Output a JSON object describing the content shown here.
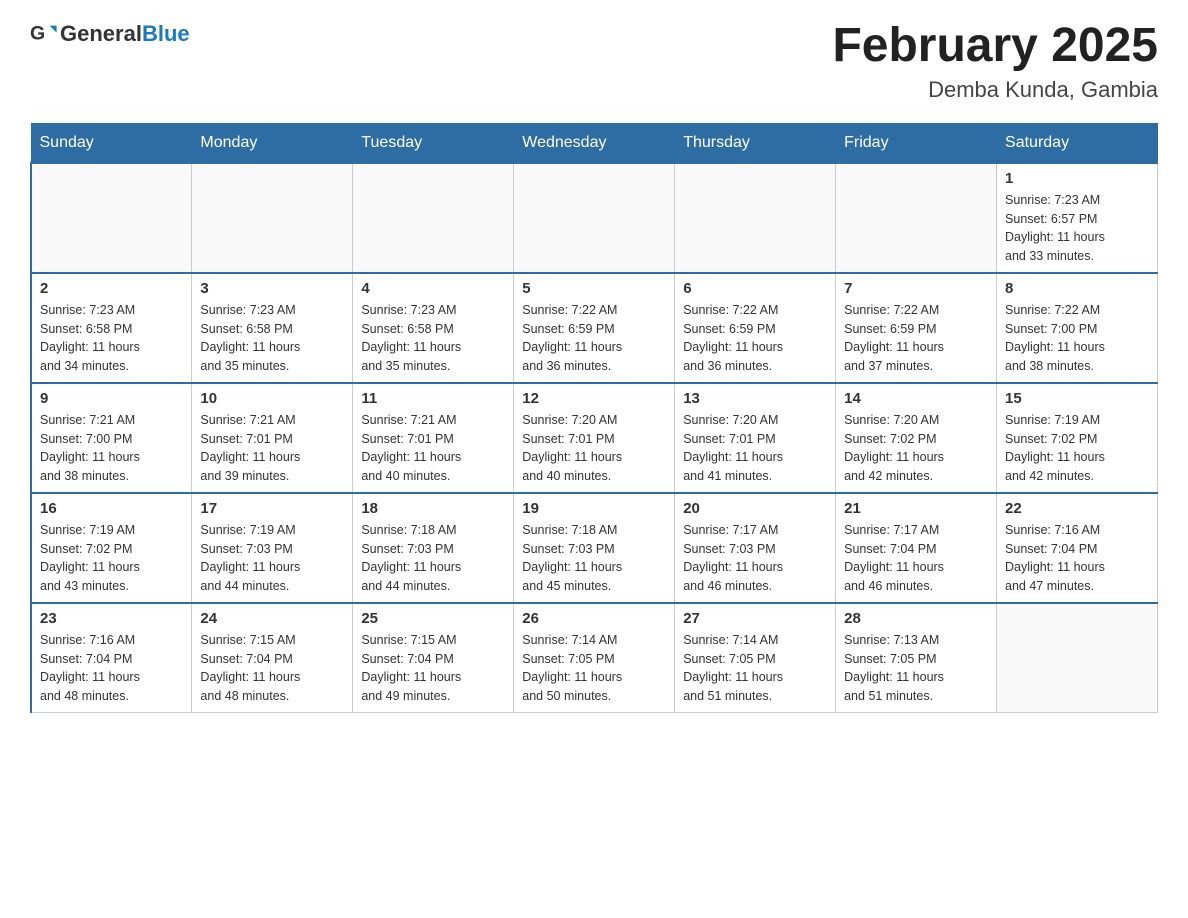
{
  "header": {
    "logo_general": "General",
    "logo_blue": "Blue",
    "month_title": "February 2025",
    "location": "Demba Kunda, Gambia"
  },
  "days_of_week": [
    "Sunday",
    "Monday",
    "Tuesday",
    "Wednesday",
    "Thursday",
    "Friday",
    "Saturday"
  ],
  "weeks": [
    {
      "days": [
        {
          "num": "",
          "info": ""
        },
        {
          "num": "",
          "info": ""
        },
        {
          "num": "",
          "info": ""
        },
        {
          "num": "",
          "info": ""
        },
        {
          "num": "",
          "info": ""
        },
        {
          "num": "",
          "info": ""
        },
        {
          "num": "1",
          "info": "Sunrise: 7:23 AM\nSunset: 6:57 PM\nDaylight: 11 hours\nand 33 minutes."
        }
      ]
    },
    {
      "days": [
        {
          "num": "2",
          "info": "Sunrise: 7:23 AM\nSunset: 6:58 PM\nDaylight: 11 hours\nand 34 minutes."
        },
        {
          "num": "3",
          "info": "Sunrise: 7:23 AM\nSunset: 6:58 PM\nDaylight: 11 hours\nand 35 minutes."
        },
        {
          "num": "4",
          "info": "Sunrise: 7:23 AM\nSunset: 6:58 PM\nDaylight: 11 hours\nand 35 minutes."
        },
        {
          "num": "5",
          "info": "Sunrise: 7:22 AM\nSunset: 6:59 PM\nDaylight: 11 hours\nand 36 minutes."
        },
        {
          "num": "6",
          "info": "Sunrise: 7:22 AM\nSunset: 6:59 PM\nDaylight: 11 hours\nand 36 minutes."
        },
        {
          "num": "7",
          "info": "Sunrise: 7:22 AM\nSunset: 6:59 PM\nDaylight: 11 hours\nand 37 minutes."
        },
        {
          "num": "8",
          "info": "Sunrise: 7:22 AM\nSunset: 7:00 PM\nDaylight: 11 hours\nand 38 minutes."
        }
      ]
    },
    {
      "days": [
        {
          "num": "9",
          "info": "Sunrise: 7:21 AM\nSunset: 7:00 PM\nDaylight: 11 hours\nand 38 minutes."
        },
        {
          "num": "10",
          "info": "Sunrise: 7:21 AM\nSunset: 7:01 PM\nDaylight: 11 hours\nand 39 minutes."
        },
        {
          "num": "11",
          "info": "Sunrise: 7:21 AM\nSunset: 7:01 PM\nDaylight: 11 hours\nand 40 minutes."
        },
        {
          "num": "12",
          "info": "Sunrise: 7:20 AM\nSunset: 7:01 PM\nDaylight: 11 hours\nand 40 minutes."
        },
        {
          "num": "13",
          "info": "Sunrise: 7:20 AM\nSunset: 7:01 PM\nDaylight: 11 hours\nand 41 minutes."
        },
        {
          "num": "14",
          "info": "Sunrise: 7:20 AM\nSunset: 7:02 PM\nDaylight: 11 hours\nand 42 minutes."
        },
        {
          "num": "15",
          "info": "Sunrise: 7:19 AM\nSunset: 7:02 PM\nDaylight: 11 hours\nand 42 minutes."
        }
      ]
    },
    {
      "days": [
        {
          "num": "16",
          "info": "Sunrise: 7:19 AM\nSunset: 7:02 PM\nDaylight: 11 hours\nand 43 minutes."
        },
        {
          "num": "17",
          "info": "Sunrise: 7:19 AM\nSunset: 7:03 PM\nDaylight: 11 hours\nand 44 minutes."
        },
        {
          "num": "18",
          "info": "Sunrise: 7:18 AM\nSunset: 7:03 PM\nDaylight: 11 hours\nand 44 minutes."
        },
        {
          "num": "19",
          "info": "Sunrise: 7:18 AM\nSunset: 7:03 PM\nDaylight: 11 hours\nand 45 minutes."
        },
        {
          "num": "20",
          "info": "Sunrise: 7:17 AM\nSunset: 7:03 PM\nDaylight: 11 hours\nand 46 minutes."
        },
        {
          "num": "21",
          "info": "Sunrise: 7:17 AM\nSunset: 7:04 PM\nDaylight: 11 hours\nand 46 minutes."
        },
        {
          "num": "22",
          "info": "Sunrise: 7:16 AM\nSunset: 7:04 PM\nDaylight: 11 hours\nand 47 minutes."
        }
      ]
    },
    {
      "days": [
        {
          "num": "23",
          "info": "Sunrise: 7:16 AM\nSunset: 7:04 PM\nDaylight: 11 hours\nand 48 minutes."
        },
        {
          "num": "24",
          "info": "Sunrise: 7:15 AM\nSunset: 7:04 PM\nDaylight: 11 hours\nand 48 minutes."
        },
        {
          "num": "25",
          "info": "Sunrise: 7:15 AM\nSunset: 7:04 PM\nDaylight: 11 hours\nand 49 minutes."
        },
        {
          "num": "26",
          "info": "Sunrise: 7:14 AM\nSunset: 7:05 PM\nDaylight: 11 hours\nand 50 minutes."
        },
        {
          "num": "27",
          "info": "Sunrise: 7:14 AM\nSunset: 7:05 PM\nDaylight: 11 hours\nand 51 minutes."
        },
        {
          "num": "28",
          "info": "Sunrise: 7:13 AM\nSunset: 7:05 PM\nDaylight: 11 hours\nand 51 minutes."
        },
        {
          "num": "",
          "info": ""
        }
      ]
    }
  ]
}
